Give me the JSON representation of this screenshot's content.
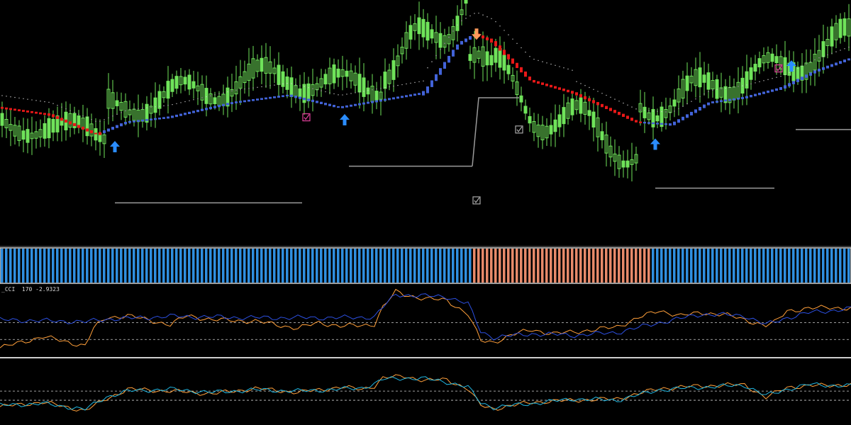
{
  "colors": {
    "background": "#000000",
    "candle": "#6fe35a",
    "trend_up": "#4263d8",
    "trend_down": "#e81818",
    "dots": "#c8c8c8",
    "level_line": "#9a9a9a",
    "buy_arrow": "#2a8cff",
    "sell_arrow": "#ff9a5a",
    "exit_mark": "#e0409a",
    "check_mark": "#a8a8a8",
    "hist_up": "#2f8fe0",
    "hist_down": "#e88a6a",
    "cci_fast": "#ff9f3a",
    "cci_slow": "#2c4fe0",
    "cci_alt": "#20b6e0",
    "separator": "#cfcfcf",
    "dashed_level": "#cfcfcf"
  },
  "chart_data": [
    {
      "type": "candlestick",
      "pane": "price",
      "title": "",
      "x_range": [
        0,
        200
      ],
      "y_range": [
        0,
        100
      ],
      "trend_line": {
        "x": [
          0,
          12,
          23,
          30,
          40,
          55,
          68,
          80,
          90,
          100,
          108,
          112,
          116,
          125,
          135,
          145,
          150,
          158,
          167,
          175,
          184,
          192,
          200
        ],
        "y": [
          56,
          53,
          45,
          50,
          52,
          58,
          61,
          56,
          59,
          62,
          82,
          86,
          83,
          67,
          62,
          54,
          50,
          49,
          58,
          60,
          64,
          71,
          76
        ],
        "direction": [
          "up-start",
          "down",
          "down",
          "up",
          "up",
          "up",
          "up",
          "down",
          "up",
          "up",
          "up",
          "up",
          "down",
          "down",
          "down",
          "down",
          "down",
          "up",
          "up",
          "up",
          "up",
          "up",
          "up"
        ]
      },
      "level_lines": [
        {
          "x": [
            27,
            71
          ],
          "y": 17
        },
        {
          "x": [
            82,
            111
          ],
          "y": 32
        },
        {
          "x": [
            154,
            182
          ],
          "y": 23
        },
        {
          "x": [
            187,
            200
          ],
          "y": 47
        }
      ],
      "signals": [
        {
          "type": "buy",
          "x": 27,
          "y": 40
        },
        {
          "type": "buy",
          "x": 81,
          "y": 51
        },
        {
          "type": "buy",
          "x": 154,
          "y": 41
        },
        {
          "type": "buy",
          "x": 186,
          "y": 73
        },
        {
          "type": "sell",
          "x": 112,
          "y": 86
        },
        {
          "type": "exit",
          "x": 72,
          "y": 52
        },
        {
          "type": "exit",
          "x": 183,
          "y": 72
        },
        {
          "type": "check",
          "x": 112,
          "y": 18
        },
        {
          "type": "check",
          "x": 122,
          "y": 47
        }
      ]
    },
    {
      "type": "histogram",
      "pane": "trend",
      "segments": [
        {
          "state": "up",
          "x": [
            0,
            111
          ]
        },
        {
          "state": "down",
          "x": [
            111,
            153
          ]
        },
        {
          "state": "up",
          "x": [
            153,
            200
          ]
        }
      ]
    },
    {
      "type": "line",
      "pane": "CCI",
      "label": "_CCI  170 -2.9323",
      "series": [
        {
          "color": "cci_fast",
          "x": [
            0,
            10,
            20,
            22,
            25,
            30,
            40,
            44,
            50,
            60,
            65,
            70,
            75,
            80,
            85,
            88,
            90,
            93,
            95,
            100,
            105,
            110,
            113,
            116,
            120,
            125,
            130,
            135,
            140,
            145,
            150,
            155,
            160,
            165,
            170,
            175,
            180,
            182,
            185,
            190,
            195,
            200
          ],
          "y": [
            12,
            28,
            15,
            40,
            55,
            58,
            45,
            58,
            52,
            50,
            45,
            40,
            48,
            43,
            44,
            46,
            70,
            92,
            88,
            82,
            80,
            60,
            22,
            20,
            30,
            38,
            32,
            35,
            38,
            42,
            55,
            65,
            58,
            62,
            60,
            52,
            44,
            48,
            65,
            68,
            70,
            68
          ]
        },
        {
          "color": "cci_slow",
          "x": [
            0,
            15,
            20,
            25,
            30,
            40,
            60,
            80,
            88,
            90,
            93,
            100,
            105,
            110,
            113,
            116,
            125,
            135,
            145,
            155,
            165,
            175,
            180,
            185,
            190,
            200
          ],
          "y": [
            52,
            50,
            49,
            53,
            54,
            57,
            55,
            55,
            56,
            70,
            88,
            86,
            85,
            75,
            35,
            27,
            32,
            30,
            34,
            48,
            60,
            58,
            45,
            55,
            62,
            68
          ]
        }
      ],
      "levels": [
        48,
        24
      ]
    },
    {
      "type": "line",
      "pane": "oscillator",
      "series": [
        {
          "color": "cci_fast",
          "x": [
            0,
            10,
            20,
            25,
            30,
            40,
            50,
            60,
            70,
            80,
            85,
            88,
            90,
            95,
            100,
            105,
            110,
            113,
            116,
            125,
            135,
            145,
            155,
            165,
            175,
            180,
            185,
            190,
            200
          ],
          "y": [
            28,
            35,
            22,
            40,
            55,
            52,
            48,
            56,
            50,
            58,
            55,
            60,
            72,
            75,
            68,
            70,
            55,
            30,
            25,
            35,
            38,
            40,
            56,
            60,
            62,
            42,
            58,
            60,
            62
          ]
        },
        {
          "color": "cci_alt",
          "x": [
            0,
            10,
            20,
            25,
            30,
            40,
            50,
            60,
            70,
            80,
            85,
            88,
            90,
            95,
            100,
            105,
            110,
            113,
            116,
            125,
            135,
            145,
            155,
            165,
            175,
            180,
            185,
            190,
            200
          ],
          "y": [
            30,
            33,
            24,
            43,
            52,
            55,
            50,
            54,
            52,
            55,
            57,
            63,
            70,
            72,
            71,
            66,
            58,
            34,
            27,
            33,
            40,
            38,
            54,
            58,
            61,
            45,
            55,
            62,
            60
          ]
        }
      ],
      "levels": [
        52,
        38
      ]
    }
  ]
}
